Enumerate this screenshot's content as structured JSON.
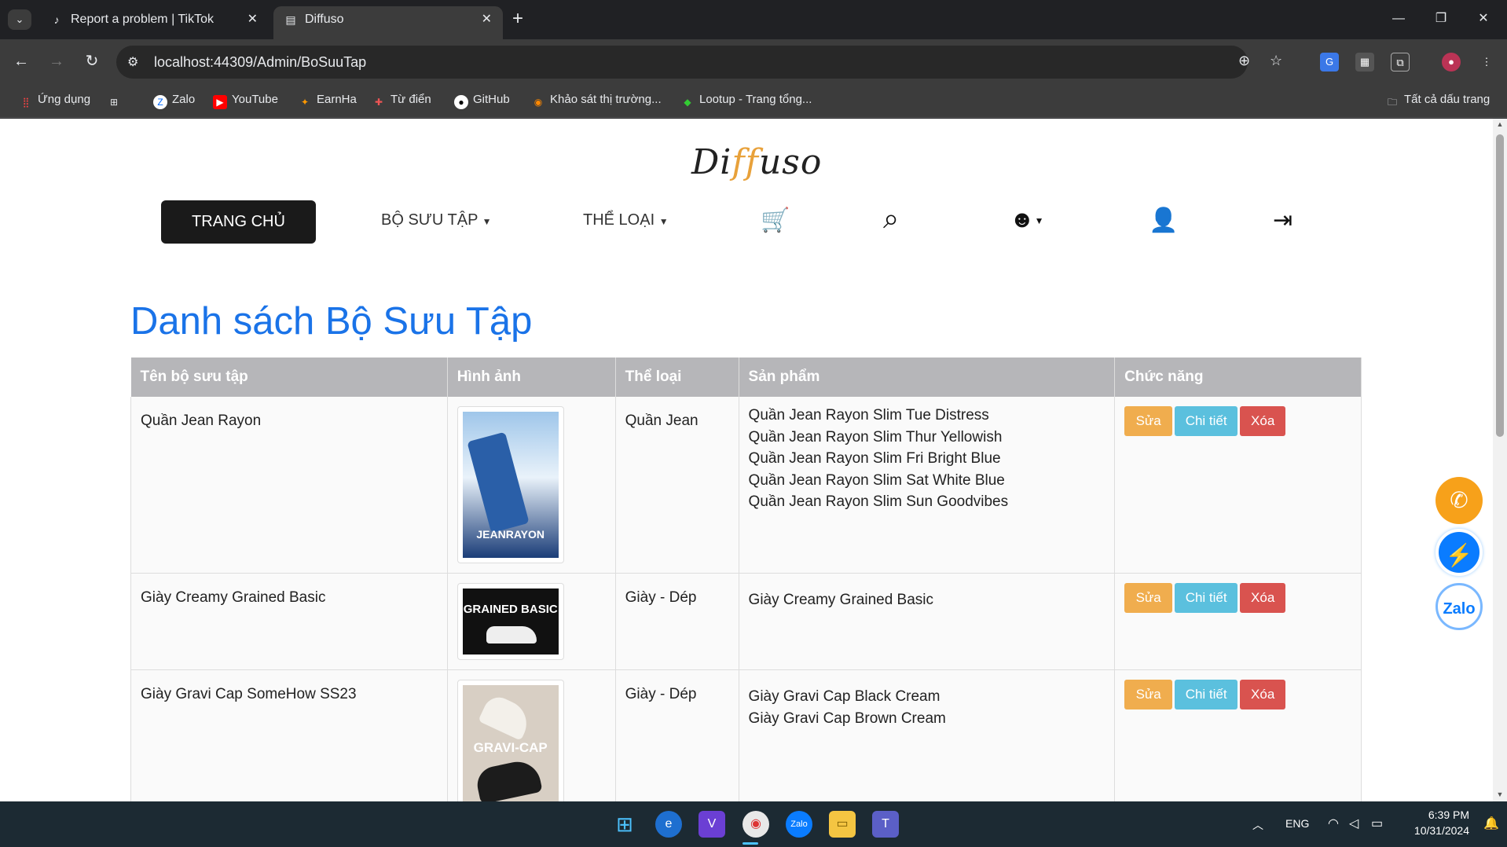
{
  "browser": {
    "tabs": [
      {
        "title": "Report a problem | TikTok",
        "active": false
      },
      {
        "title": "Diffuso",
        "active": true
      }
    ],
    "url": "localhost:44309/Admin/BoSuuTap",
    "bookmarks": [
      {
        "label": "Ứng dụng",
        "icon": "apps-grid-icon"
      },
      {
        "label": "",
        "icon": "grid-icon"
      },
      {
        "label": "Zalo",
        "icon": "zalo-icon"
      },
      {
        "label": "YouTube",
        "icon": "youtube-icon"
      },
      {
        "label": "EarnHa",
        "icon": "earnha-icon"
      },
      {
        "label": "Từ điển",
        "icon": "dictionary-icon"
      },
      {
        "label": "GitHub",
        "icon": "github-icon"
      },
      {
        "label": "Khảo sát thị trường...",
        "icon": "survey-icon"
      },
      {
        "label": "Lootup - Trang tổng...",
        "icon": "lootup-icon"
      }
    ],
    "all_bookmarks": "Tất cả dấu trang"
  },
  "site": {
    "logo_pre": "Di",
    "logo_ff": "ff",
    "logo_post": "uso",
    "nav": {
      "home": "TRANG CHỦ",
      "collections": "BỘ SƯU TẬP",
      "categories": "THỂ LOẠI"
    },
    "page_title": "Danh sách Bộ Sưu Tập",
    "table": {
      "headers": [
        "Tên bộ sưu tập",
        "Hình ảnh",
        "Thể loại",
        "Sản phẩm",
        "Chức năng"
      ],
      "rows": [
        {
          "name": "Quần Jean Rayon",
          "image_text": "JEANRAYON",
          "category": "Quần Jean",
          "products": [
            "Quần Jean Rayon Slim Tue Distress",
            "Quần Jean Rayon Slim Thur Yellowish",
            "Quần Jean Rayon Slim Fri Bright Blue",
            "Quần Jean Rayon Slim Sat White Blue",
            "Quần Jean Rayon Slim Sun Goodvibes"
          ]
        },
        {
          "name": "Giày Creamy Grained Basic",
          "image_text": "GRAINED BASIC",
          "category": "Giày - Dép",
          "products": [
            "Giày Creamy Grained Basic"
          ]
        },
        {
          "name": "Giày Gravi Cap SomeHow SS23",
          "image_text": "GRAVI-CAP",
          "category": "Giày - Dép",
          "products": [
            "Giày Gravi Cap Black Cream",
            "Giày Gravi Cap Brown Cream"
          ]
        }
      ],
      "actions": {
        "edit": "Sửa",
        "detail": "Chi tiết",
        "delete": "Xóa"
      }
    }
  },
  "taskbar": {
    "lang": "ENG",
    "time": "6:39 PM",
    "date": "10/31/2024"
  },
  "colors": {
    "title_blue": "#1a73e8",
    "edit": "#f0ad4e",
    "detail": "#5bc0de",
    "delete": "#d9534f"
  }
}
